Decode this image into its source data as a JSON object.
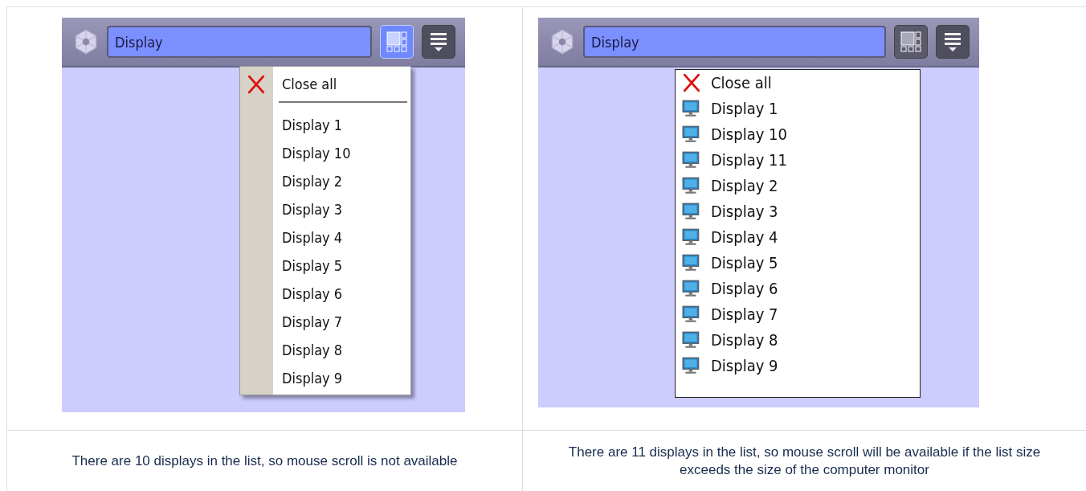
{
  "panels": [
    {
      "toolbar": {
        "field_value": "Display",
        "grid_button_selected": true
      },
      "menu": {
        "kind": "gutter",
        "items": [
          {
            "kind": "close",
            "label": "Close all"
          },
          {
            "kind": "separator"
          },
          {
            "kind": "display",
            "label": "Display 1"
          },
          {
            "kind": "display",
            "label": "Display 10"
          },
          {
            "kind": "display",
            "label": "Display 2"
          },
          {
            "kind": "display",
            "label": "Display 3"
          },
          {
            "kind": "display",
            "label": "Display 4"
          },
          {
            "kind": "display",
            "label": "Display 5"
          },
          {
            "kind": "display",
            "label": "Display 6"
          },
          {
            "kind": "display",
            "label": "Display 7"
          },
          {
            "kind": "display",
            "label": "Display 8"
          },
          {
            "kind": "display",
            "label": "Display 9"
          }
        ]
      },
      "caption": "There are 10 displays in the list, so mouse scroll is not available"
    },
    {
      "toolbar": {
        "field_value": "Display",
        "grid_button_selected": false
      },
      "menu": {
        "kind": "icons",
        "items": [
          {
            "kind": "close",
            "label": "Close all"
          },
          {
            "kind": "display",
            "label": "Display 1"
          },
          {
            "kind": "display",
            "label": "Display 10"
          },
          {
            "kind": "display",
            "label": "Display 11"
          },
          {
            "kind": "display",
            "label": "Display 2"
          },
          {
            "kind": "display",
            "label": "Display 3"
          },
          {
            "kind": "display",
            "label": "Display 4"
          },
          {
            "kind": "display",
            "label": "Display 5"
          },
          {
            "kind": "display",
            "label": "Display 6"
          },
          {
            "kind": "display",
            "label": "Display 7"
          },
          {
            "kind": "display",
            "label": "Display 8"
          },
          {
            "kind": "display",
            "label": "Display 9"
          }
        ]
      },
      "caption": "There are 11 displays in the list, so mouse scroll will be available if the list size exceeds the size of the computer monitor"
    }
  ]
}
